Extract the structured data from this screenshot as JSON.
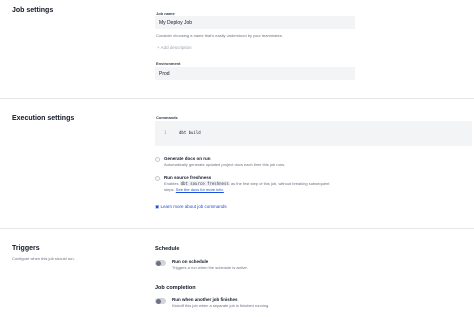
{
  "job_settings": {
    "title": "Job settings",
    "job_name_label": "Job name",
    "job_name_value": "My Deploy Job",
    "job_name_help": "Consider choosing a name that's easily understood by your teammates.",
    "add_description": "Add description",
    "environment_label": "Environment",
    "environment_value": "Prod"
  },
  "execution_settings": {
    "title": "Execution settings",
    "commands_label": "Commands",
    "command_line_number": "1",
    "command_text": "dbt build",
    "generate_docs_title": "Generate docs on run",
    "generate_docs_desc": "Automatically generate updated project docs each time this job runs.",
    "source_freshness_title": "Run source freshness",
    "source_freshness_desc_1": "Enables",
    "source_freshness_code": "dbt source freshness",
    "source_freshness_desc_2": "as the first step of this job, without breaking subsequent",
    "source_freshness_desc_3": "steps.",
    "source_freshness_link": "See the docs for more info.",
    "learn_more": "Learn more about job commands"
  },
  "triggers": {
    "title": "Triggers",
    "help": "Configure when this job should run.",
    "schedule_heading": "Schedule",
    "schedule_title": "Run on schedule",
    "schedule_desc": "Triggers a run when the schedule is active.",
    "completion_heading": "Job completion",
    "completion_title": "Run when another job finishes",
    "completion_desc": "Kickoff this job when a separate job is finished running."
  },
  "colors": {
    "link": "#1d4ed8",
    "field_bg": "#f3f4f6",
    "toggle_off": "#d1d5db"
  },
  "icons": {
    "add": "plus-icon",
    "docs": "book-icon"
  }
}
